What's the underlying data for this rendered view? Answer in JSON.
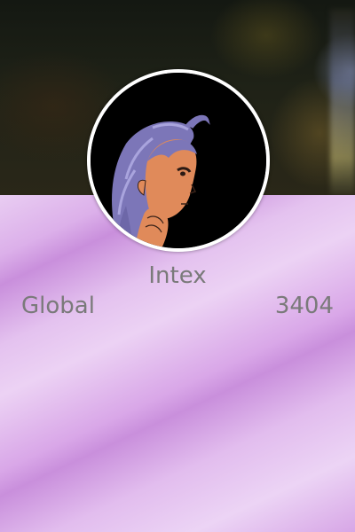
{
  "profile": {
    "username": "Intex",
    "rank_label": "Global",
    "rank_value": "3404"
  },
  "avatar": {
    "icon": "anime-girl-portrait",
    "border_color": "#ffffff"
  },
  "colors": {
    "text": "#7a7a7a",
    "background_accent": "#c98fdc"
  }
}
